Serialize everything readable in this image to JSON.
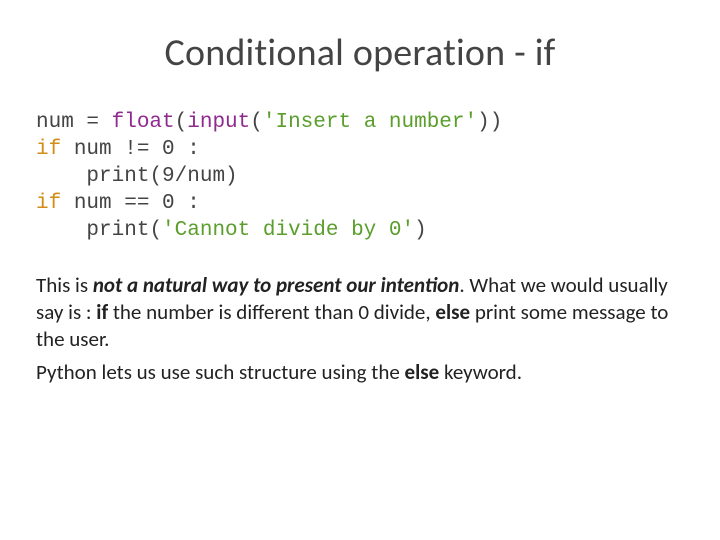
{
  "title": "Conditional operation - if",
  "code": {
    "l1a": "num = ",
    "l1b": "float",
    "l1c": "(",
    "l1d": "input",
    "l1e": "(",
    "l1f": "'Insert a number'",
    "l1g": "))",
    "l2a": "if",
    "l2b": " num != 0 :",
    "l3a": "    ",
    "l3b": "print",
    "l3c": "(9/num)",
    "l4a": "if",
    "l4b": " num == 0 :",
    "l5a": "    ",
    "l5b": "print",
    "l5c": "(",
    "l5d": "'Cannot divide by 0'",
    "l5e": ")"
  },
  "para1": {
    "t1": "This is ",
    "t2": "not a natural way to present our intention",
    "t3": ". What we would usually say is : ",
    "t4": "if ",
    "t5": " the number is different than 0 divide, ",
    "t6": "else ",
    "t7": "print some message to the user."
  },
  "para2": {
    "t1": "Python lets us use such structure using the ",
    "t2": "else ",
    "t3": "keyword."
  }
}
